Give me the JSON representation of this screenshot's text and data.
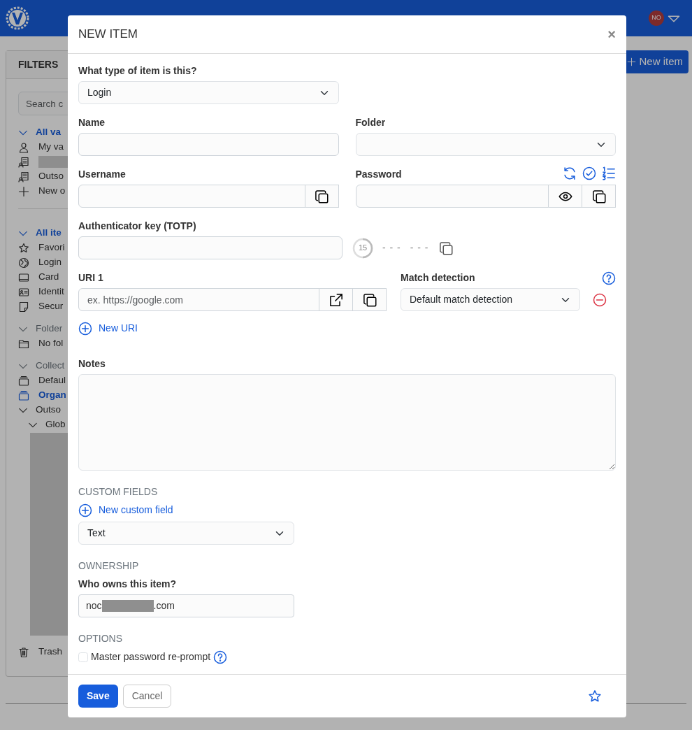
{
  "navbar": {
    "avatar": "NO"
  },
  "sidebar": {
    "title": "FILTERS",
    "search_placeholder": "Search c",
    "sections": [
      {
        "label": "All va",
        "selected": true,
        "expanded": true,
        "items": [
          {
            "kind": "person",
            "label": "My va"
          },
          {
            "kind": "org",
            "redacted": true
          },
          {
            "kind": "org",
            "label": "Outso"
          },
          {
            "kind": "add",
            "label": "New o"
          }
        ]
      },
      {
        "label": "All ite",
        "selected": true,
        "expanded": true,
        "items": [
          {
            "kind": "star",
            "label": "Favori"
          },
          {
            "kind": "globe",
            "label": "Login"
          },
          {
            "kind": "card",
            "label": "Card"
          },
          {
            "kind": "id",
            "label": "Identit"
          },
          {
            "kind": "note",
            "label": "Secur"
          }
        ]
      },
      {
        "label": "Folder",
        "selected": false,
        "expanded": true,
        "items": [
          {
            "kind": "folder",
            "label": "No fol"
          }
        ]
      },
      {
        "label": "Collect",
        "selected": false,
        "expanded": true,
        "items": [
          {
            "kind": "collection",
            "label": "Defaul",
            "selected": false
          },
          {
            "kind": "collection",
            "label": "Organ",
            "selected": true
          },
          {
            "kind": "tree",
            "label": "Outso",
            "expanded": true,
            "children": [
              {
                "label": "Glob",
                "expanded": true,
                "children": [
                  {
                    "redacted": true
                  }
                ]
              }
            ]
          }
        ]
      }
    ],
    "trash": "Trash"
  },
  "new_item_button": "New item",
  "modal": {
    "title": "NEW ITEM",
    "close": "×",
    "type_field": {
      "label": "What type of item is this?",
      "value": "Login"
    },
    "name_field": {
      "label": "Name"
    },
    "folder_field": {
      "label": "Folder"
    },
    "username_field": {
      "label": "Username"
    },
    "password_field": {
      "label": "Password"
    },
    "totp_field": {
      "label": "Authenticator key (TOTP)",
      "countdown": "15",
      "code": [
        "- - -",
        "- - -"
      ]
    },
    "uris": [
      {
        "label": "URI 1",
        "placeholder": "ex. https://google.com",
        "match_label": "Match detection",
        "match_value": "Default match detection"
      }
    ],
    "new_uri": "New URI",
    "notes": {
      "label": "Notes"
    },
    "custom_fields": {
      "heading": "CUSTOM FIELDS",
      "add": "New custom field",
      "type_value": "Text"
    },
    "ownership": {
      "heading": "OWNERSHIP",
      "label": "Who owns this item?",
      "value_start": "noc",
      "value_end": ".com"
    },
    "options": {
      "heading": "OPTIONS",
      "reprompt": {
        "label": "Master password re-prompt",
        "checked": false
      }
    },
    "footer": {
      "save": "Save",
      "cancel": "Cancel",
      "favorite": false
    }
  }
}
